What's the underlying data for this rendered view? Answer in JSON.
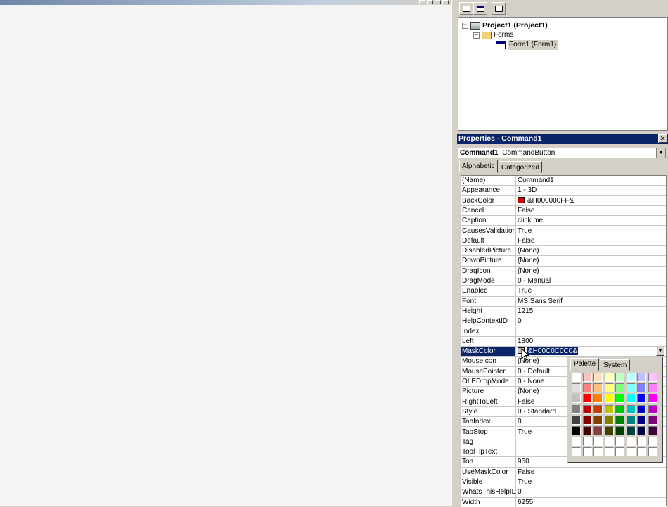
{
  "project": {
    "root_label": "Project1 (Project1)",
    "folder_label": "Forms",
    "form_label": "Form1 (Form1)"
  },
  "properties": {
    "title": "Properties - Command1",
    "close_glyph": "✕",
    "object_name": "Command1",
    "object_type": "CommandButton",
    "tabs": [
      "Alphabetic",
      "Categorized"
    ],
    "rows": [
      {
        "name": "(Name)",
        "value": "Command1"
      },
      {
        "name": "Appearance",
        "value": "1 - 3D"
      },
      {
        "name": "BackColor",
        "value": "&H000000FF&",
        "swatch": "#e00000"
      },
      {
        "name": "Cancel",
        "value": "False"
      },
      {
        "name": "Caption",
        "value": "click me"
      },
      {
        "name": "CausesValidation",
        "value": "True"
      },
      {
        "name": "Default",
        "value": "False"
      },
      {
        "name": "DisabledPicture",
        "value": "(None)"
      },
      {
        "name": "DownPicture",
        "value": "(None)"
      },
      {
        "name": "DragIcon",
        "value": "(None)"
      },
      {
        "name": "DragMode",
        "value": "0 - Manual"
      },
      {
        "name": "Enabled",
        "value": "True"
      },
      {
        "name": "Font",
        "value": "MS Sans Serif"
      },
      {
        "name": "Height",
        "value": "1215"
      },
      {
        "name": "HelpContextID",
        "value": "0"
      },
      {
        "name": "Index",
        "value": ""
      },
      {
        "name": "Left",
        "value": "1800"
      },
      {
        "name": "MaskColor",
        "value": "&H00C0C0C0&",
        "swatch": "#c0c0c0",
        "selected": true
      },
      {
        "name": "MouseIcon",
        "value": "(None)"
      },
      {
        "name": "MousePointer",
        "value": "0 - Default"
      },
      {
        "name": "OLEDropMode",
        "value": "0 - None"
      },
      {
        "name": "Picture",
        "value": "(None)"
      },
      {
        "name": "RightToLeft",
        "value": "False"
      },
      {
        "name": "Style",
        "value": "0 - Standard"
      },
      {
        "name": "TabIndex",
        "value": "0"
      },
      {
        "name": "TabStop",
        "value": "True"
      },
      {
        "name": "Tag",
        "value": ""
      },
      {
        "name": "ToolTipText",
        "value": ""
      },
      {
        "name": "Top",
        "value": "960"
      },
      {
        "name": "UseMaskColor",
        "value": "False"
      },
      {
        "name": "Visible",
        "value": "True"
      },
      {
        "name": "WhatsThisHelpID",
        "value": "0"
      },
      {
        "name": "Width",
        "value": "6255"
      }
    ]
  },
  "color_picker": {
    "tabs": [
      "Palette",
      "System"
    ],
    "colors": [
      "#ffffff",
      "#ffc0c0",
      "#ffe0c0",
      "#ffffc0",
      "#c0ffc0",
      "#c0ffff",
      "#c0c0ff",
      "#ffc0ff",
      "#e0e0e0",
      "#ff8080",
      "#ffc080",
      "#ffff80",
      "#80ff80",
      "#80ffff",
      "#8080ff",
      "#ff80ff",
      "#c0c0c0",
      "#ff0000",
      "#ff8000",
      "#ffff00",
      "#00ff00",
      "#00ffff",
      "#0000ff",
      "#ff00ff",
      "#808080",
      "#c00000",
      "#c04000",
      "#c0c000",
      "#00c000",
      "#00c0c0",
      "#0000c0",
      "#c000c0",
      "#404040",
      "#800000",
      "#804000",
      "#808000",
      "#008000",
      "#008080",
      "#000080",
      "#800080",
      "#000000",
      "#400000",
      "#804040",
      "#404000",
      "#004000",
      "#004040",
      "#000040",
      "#400040",
      "#ffffff",
      "#ffffff",
      "#ffffff",
      "#ffffff",
      "#ffffff",
      "#ffffff",
      "#ffffff",
      "#ffffff",
      "#ffffff",
      "#ffffff",
      "#ffffff",
      "#ffffff",
      "#ffffff",
      "#ffffff",
      "#ffffff",
      "#ffffff"
    ]
  }
}
